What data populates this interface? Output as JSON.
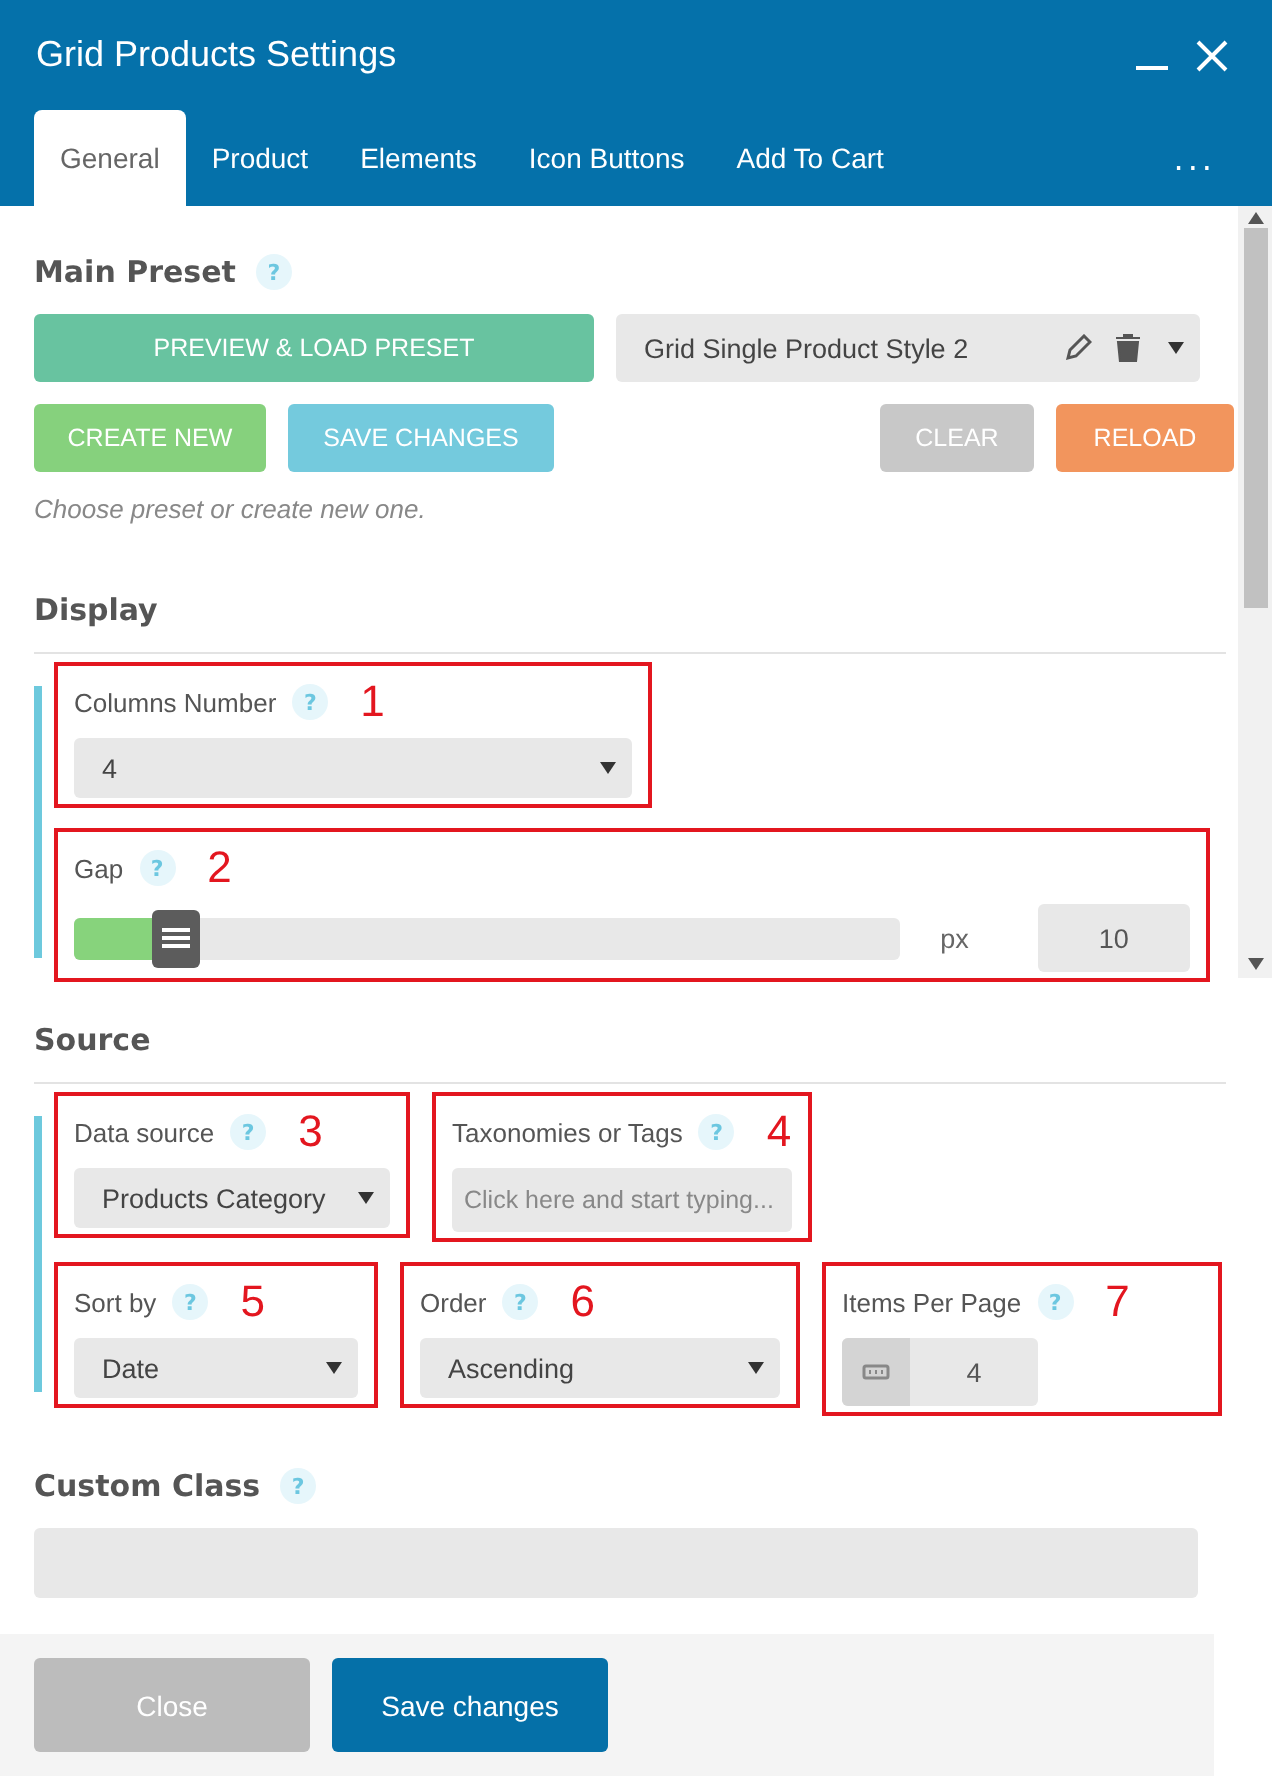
{
  "window": {
    "title": "Grid Products Settings"
  },
  "tabs": [
    {
      "label": "General",
      "selected": true
    },
    {
      "label": "Product",
      "selected": false
    },
    {
      "label": "Elements",
      "selected": false
    },
    {
      "label": "Icon Buttons",
      "selected": false
    },
    {
      "label": "Add To Cart",
      "selected": false
    }
  ],
  "more_tabs": "...",
  "main_preset": {
    "title": "Main Preset",
    "help": "?",
    "preview_button": "PREVIEW & LOAD PRESET",
    "preset_select": {
      "value": "Grid Single Product Style 2"
    },
    "buttons": [
      {
        "label": "CREATE NEW",
        "kind": "create"
      },
      {
        "label": "SAVE CHANGES",
        "kind": "save"
      },
      {
        "label": "CLEAR",
        "kind": "clear"
      },
      {
        "label": "RELOAD",
        "kind": "reload"
      }
    ],
    "hint": "Choose preset or create new one."
  },
  "sections": [
    {
      "title": "Display",
      "rows": [
        [
          {
            "kind": "select",
            "label": "Columns Number",
            "help": "?",
            "annotation": "1",
            "value": "4"
          }
        ],
        [
          {
            "kind": "slider",
            "label": "Gap",
            "help": "?",
            "annotation": "2",
            "level": 0.1,
            "unit": "px",
            "value": "10"
          }
        ]
      ]
    },
    {
      "title": "Source",
      "rows": [
        [
          {
            "kind": "select",
            "label": "Data source",
            "help": "?",
            "annotation": "3",
            "value": "Products Category"
          },
          {
            "kind": "text",
            "label": "Taxonomies or Tags",
            "help": "?",
            "annotation": "4",
            "placeholder": "Click here and start typing..."
          }
        ],
        [
          {
            "kind": "select",
            "label": "Sort by",
            "help": "?",
            "annotation": "5",
            "value": "Date"
          },
          {
            "kind": "select",
            "label": "Order",
            "help": "?",
            "annotation": "6",
            "value": "Ascending"
          },
          {
            "kind": "number",
            "label": "Items Per Page",
            "help": "?",
            "annotation": "7",
            "value": "4"
          }
        ]
      ]
    }
  ],
  "custom_class": {
    "label": "Custom Class",
    "help": "?"
  },
  "footer": {
    "buttons": [
      {
        "label": "Close",
        "kind": "close"
      },
      {
        "label": "Save changes",
        "kind": "primary"
      }
    ]
  }
}
